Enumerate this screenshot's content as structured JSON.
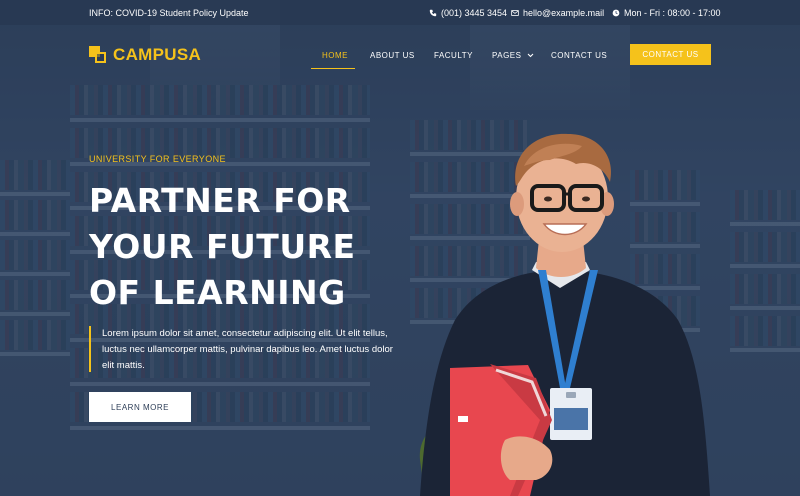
{
  "topbar": {
    "info": "INFO: COVID-19 Student Policy Update",
    "phone": "(001) 3445 3454",
    "email": "hello@example.mail",
    "hours": "Mon - Fri : 08:00 - 17:00",
    "phone_icon": "phone-icon",
    "email_icon": "mail-icon",
    "hours_icon": "clock-icon"
  },
  "brand": {
    "name": "CAMPUSA",
    "color": "#f5c21b"
  },
  "nav": {
    "items": [
      {
        "label": "HOME",
        "active": true
      },
      {
        "label": "ABOUT US"
      },
      {
        "label": "FACULTY"
      },
      {
        "label": "PAGES"
      },
      {
        "label": "CONTACT US"
      }
    ],
    "button": "CONTACT US"
  },
  "hero": {
    "eyebrow": "UNIVERSITY FOR EVERYONE",
    "headline": [
      "PARTNER FOR",
      "YOUR FUTURE",
      "OF LEARNING"
    ],
    "description": "Lorem ipsum dolor sit amet, consectetur adipiscing elit. Ut elit tellus, luctus nec ullamcorper mattis, pulvinar dapibus leo. Amet luctus dolor elit mattis.",
    "cta": "LEARN MORE"
  },
  "colors": {
    "accent": "#f5c21b",
    "overlay": "#2b3d57"
  }
}
